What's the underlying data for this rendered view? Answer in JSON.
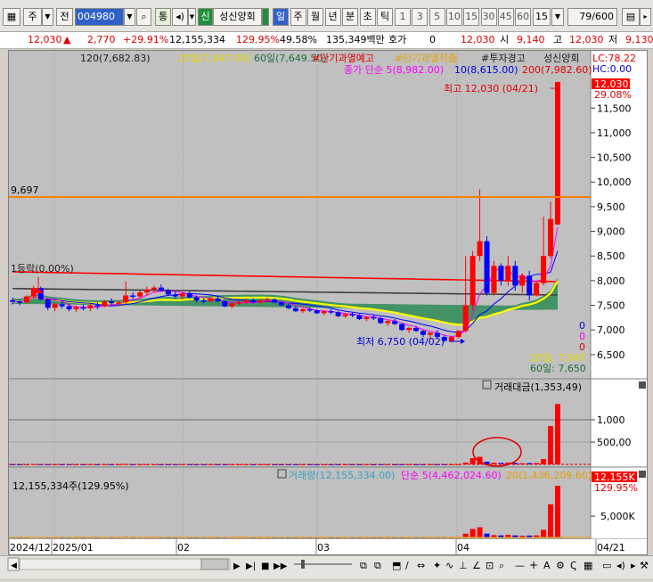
{
  "toolbar": {
    "market": "주",
    "prev_label": "전",
    "code": "004980",
    "tong": "통",
    "sin": "신",
    "name": "성신양회",
    "periods": [
      "일",
      "주",
      "월",
      "년",
      "분",
      "초",
      "틱"
    ],
    "minutes": [
      "1",
      "3",
      "5",
      "10",
      "15",
      "30",
      "45",
      "60"
    ],
    "interval": "15",
    "count": "79/600"
  },
  "quote": {
    "price": "12,030",
    "change": "2,770",
    "rate": "+29.91%",
    "volume": "12,155,334",
    "vol_ratio": "129.95%",
    "turnover": "49.58%",
    "amount": "135,349백만",
    "hoga_label": "호가",
    "hoga": "0",
    "bid": "12,030",
    "open_label": "시",
    "open": "9,140",
    "high_label": "고",
    "high": "12,030",
    "low_label": "저",
    "low": "9,130"
  },
  "chart_data": {
    "type": "candlestick",
    "legend_line1": [
      "120(7,682.83)",
      "20일(7,847.00)",
      "60일(7,649.50)",
      "#단기과열예고",
      "#단기과열적출",
      "#투자경고",
      "성신양회"
    ],
    "legend_line2": [
      "종가 단순 5(8,982.00)",
      "10(8,615.00)",
      "200(7,982.60)"
    ],
    "lc": "LC:78.22",
    "hc": "HC:0.00",
    "max_label": "최고 12,030 (04/21)",
    "min_label": "최저 6,750 (04/02)",
    "hline_label": "9,697",
    "hline_value": 9697,
    "rise_label": "1등락(0.00%)",
    "ma20_label": "20일: 7,847",
    "ma60_label": "60일: 7,650",
    "zeros": [
      "0",
      "0",
      "0"
    ],
    "current_price": "12,030",
    "current_rate": "29.08%",
    "y_ticks": [
      "11,500",
      "11,000",
      "10,500",
      "10,000",
      "9,500",
      "9,000",
      "8,500",
      "8,000",
      "7,500",
      "7,000",
      "6,500"
    ],
    "y_values": [
      11500,
      11000,
      10500,
      10000,
      9500,
      9000,
      8500,
      8000,
      7500,
      7000,
      6500
    ],
    "ylim": [
      6100,
      12300
    ],
    "x_labels": [
      "2024/12",
      "2025/01",
      "02",
      "03",
      "04",
      "04/21"
    ],
    "ohlc": [
      [
        7600,
        7650,
        7520,
        7580
      ],
      [
        7580,
        7620,
        7500,
        7560
      ],
      [
        7560,
        7700,
        7540,
        7680
      ],
      [
        7680,
        7900,
        7640,
        7850
      ],
      [
        7850,
        7880,
        7600,
        7620
      ],
      [
        7620,
        7640,
        7400,
        7450
      ],
      [
        7450,
        7560,
        7380,
        7520
      ],
      [
        7520,
        7580,
        7440,
        7480
      ],
      [
        7480,
        7520,
        7380,
        7420
      ],
      [
        7420,
        7500,
        7360,
        7460
      ],
      [
        7460,
        7520,
        7400,
        7440
      ],
      [
        7440,
        7520,
        7380,
        7500
      ],
      [
        7500,
        7560,
        7420,
        7480
      ],
      [
        7480,
        7600,
        7460,
        7580
      ],
      [
        7580,
        7640,
        7500,
        7540
      ],
      [
        7540,
        7600,
        7480,
        7560
      ],
      [
        7560,
        7980,
        7520,
        7700
      ],
      [
        7700,
        7760,
        7620,
        7680
      ],
      [
        7680,
        7800,
        7640,
        7760
      ],
      [
        7760,
        7880,
        7700,
        7820
      ],
      [
        7820,
        7900,
        7760,
        7860
      ],
      [
        7860,
        7920,
        7780,
        7800
      ],
      [
        7800,
        7840,
        7700,
        7720
      ],
      [
        7720,
        7780,
        7640,
        7680
      ],
      [
        7680,
        7760,
        7620,
        7740
      ],
      [
        7740,
        7780,
        7640,
        7660
      ],
      [
        7660,
        7700,
        7560,
        7600
      ],
      [
        7600,
        7640,
        7540,
        7580
      ],
      [
        7580,
        7660,
        7560,
        7640
      ],
      [
        7640,
        7680,
        7560,
        7580
      ],
      [
        7580,
        7600,
        7460,
        7480
      ],
      [
        7480,
        7560,
        7440,
        7540
      ],
      [
        7540,
        7600,
        7500,
        7560
      ],
      [
        7560,
        7640,
        7520,
        7600
      ],
      [
        7600,
        7640,
        7540,
        7560
      ],
      [
        7560,
        7620,
        7520,
        7600
      ],
      [
        7600,
        7660,
        7560,
        7620
      ],
      [
        7620,
        7640,
        7540,
        7560
      ],
      [
        7560,
        7580,
        7480,
        7500
      ],
      [
        7500,
        7540,
        7420,
        7440
      ],
      [
        7440,
        7480,
        7360,
        7380
      ],
      [
        7380,
        7440,
        7340,
        7420
      ],
      [
        7420,
        7460,
        7360,
        7400
      ],
      [
        7400,
        7420,
        7320,
        7340
      ],
      [
        7340,
        7400,
        7300,
        7380
      ],
      [
        7380,
        7420,
        7320,
        7360
      ],
      [
        7360,
        7380,
        7260,
        7280
      ],
      [
        7280,
        7340,
        7240,
        7320
      ],
      [
        7320,
        7360,
        7260,
        7300
      ],
      [
        7300,
        7320,
        7200,
        7220
      ],
      [
        7220,
        7280,
        7180,
        7260
      ],
      [
        7260,
        7300,
        7200,
        7240
      ],
      [
        7240,
        7260,
        7120,
        7140
      ],
      [
        7140,
        7200,
        7080,
        7180
      ],
      [
        7180,
        7220,
        7100,
        7120
      ],
      [
        7120,
        7140,
        6980,
        7000
      ],
      [
        7000,
        7060,
        6940,
        7040
      ],
      [
        7040,
        7080,
        6960,
        6980
      ],
      [
        6980,
        7000,
        6860,
        6900
      ],
      [
        6900,
        6960,
        6800,
        6940
      ],
      [
        6940,
        7000,
        6840,
        6860
      ],
      [
        6860,
        6900,
        6760,
        6780
      ],
      [
        6780,
        6880,
        6750,
        6860
      ],
      [
        6860,
        7000,
        6820,
        6980
      ],
      [
        6980,
        8500,
        6950,
        7500
      ],
      [
        7500,
        8600,
        7400,
        8500
      ],
      [
        8500,
        9850,
        8400,
        8800
      ],
      [
        8800,
        8900,
        7700,
        7750
      ],
      [
        7750,
        8400,
        7700,
        8300
      ],
      [
        8300,
        8350,
        7900,
        8000
      ],
      [
        8000,
        8500,
        7900,
        8300
      ],
      [
        8300,
        8400,
        7800,
        7900
      ],
      [
        7900,
        8150,
        7750,
        8100
      ],
      [
        8100,
        8200,
        7600,
        7700
      ],
      [
        7700,
        8000,
        7680,
        7950
      ],
      [
        7950,
        9300,
        7900,
        8500
      ],
      [
        8500,
        9600,
        8450,
        9250
      ],
      [
        9140,
        12030,
        9130,
        12030
      ]
    ],
    "vol_label": "거래대금(1,353,49)",
    "vol_ticks": [
      "1,000",
      "500,00"
    ],
    "vol_values": [
      1000,
      500
    ],
    "vol_ylim": [
      0,
      1600
    ],
    "amounts": [
      3,
      2,
      3,
      5,
      4,
      3,
      2,
      2,
      3,
      2,
      2,
      2,
      2,
      3,
      2,
      2,
      8,
      3,
      3,
      3,
      3,
      2,
      2,
      2,
      3,
      2,
      2,
      2,
      2,
      2,
      2,
      2,
      2,
      2,
      2,
      2,
      2,
      2,
      2,
      2,
      2,
      2,
      2,
      2,
      2,
      2,
      2,
      2,
      2,
      2,
      2,
      2,
      2,
      2,
      2,
      2,
      2,
      2,
      3,
      2,
      3,
      3,
      2,
      3,
      40,
      140,
      170,
      60,
      35,
      30,
      40,
      30,
      25,
      28,
      30,
      120,
      860,
      1353
    ],
    "sub_legend": [
      "거래량(12,155,334.00)",
      "단순 5(4,462,024.60)",
      "20(1,436,209.60)"
    ],
    "sub_left_label": "12,155,334주(129.95%)",
    "sub_current": "12,155K",
    "sub_current_rate": "129.95%",
    "sub_tick": "5,000K",
    "sub_tick_value": 5000,
    "sub_ylim": [
      0,
      13000
    ],
    "volumes": [
      60,
      50,
      60,
      90,
      80,
      60,
      50,
      50,
      60,
      50,
      50,
      50,
      50,
      60,
      50,
      50,
      150,
      60,
      60,
      60,
      60,
      50,
      50,
      50,
      60,
      50,
      50,
      50,
      50,
      50,
      50,
      50,
      50,
      50,
      50,
      50,
      50,
      50,
      50,
      50,
      50,
      50,
      50,
      50,
      50,
      50,
      50,
      50,
      50,
      50,
      50,
      50,
      50,
      50,
      50,
      50,
      50,
      50,
      60,
      50,
      60,
      60,
      50,
      60,
      900,
      2000,
      2400,
      900,
      550,
      480,
      600,
      480,
      400,
      450,
      500,
      1800,
      7800,
      12155
    ]
  },
  "colors": {
    "up": "#ff0000",
    "down": "#0000ff",
    "ma5": "#ff00ff",
    "ma10": "#0000ff",
    "ma20": "#ffff00",
    "ma60": "#2e8b57",
    "ma120": "#404040",
    "ma200": "#ff0000",
    "hline": "#ff8000"
  }
}
